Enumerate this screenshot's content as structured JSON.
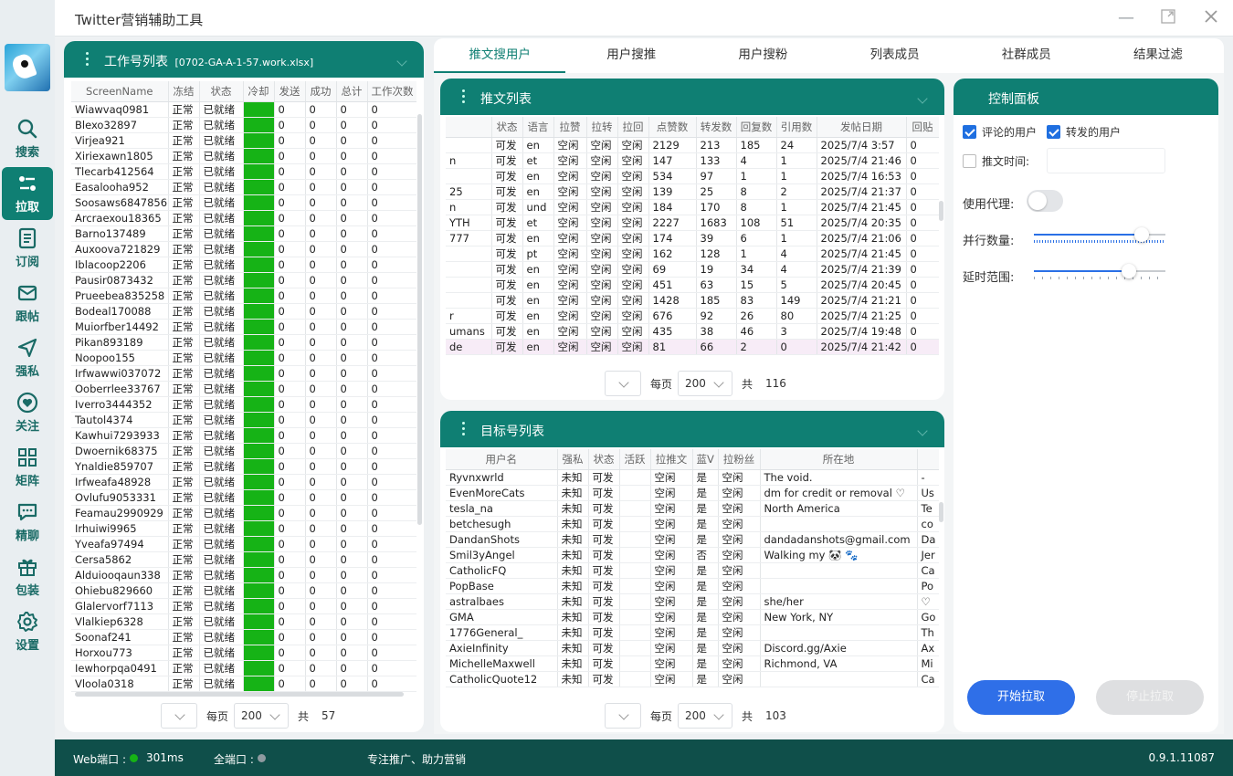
{
  "window": {
    "title": "Twitter营销辅助工具"
  },
  "nav": [
    {
      "key": "search",
      "label": "搜索",
      "icon": "search-icon"
    },
    {
      "key": "pull",
      "label": "拉取",
      "icon": "pull-icon"
    },
    {
      "key": "subscribe",
      "label": "订阅",
      "icon": "document-icon"
    },
    {
      "key": "follow-post",
      "label": "跟帖",
      "icon": "mail-icon"
    },
    {
      "key": "dm",
      "label": "强私",
      "icon": "send-icon"
    },
    {
      "key": "follow",
      "label": "关注",
      "icon": "heart-icon"
    },
    {
      "key": "matrix",
      "label": "矩阵",
      "icon": "grid-icon"
    },
    {
      "key": "chat",
      "label": "精聊",
      "icon": "chat-icon"
    },
    {
      "key": "pack",
      "label": "包装",
      "icon": "gift-icon"
    },
    {
      "key": "settings",
      "label": "设置",
      "icon": "gear-icon"
    }
  ],
  "workers": {
    "title": "工作号列表",
    "file": "[0702-GA-A-1-57.work.xlsx]",
    "columns": [
      "ScreenName",
      "冻结",
      "状态",
      "冷却",
      "发送",
      "成功",
      "总计",
      "工作次数"
    ],
    "rows": [
      [
        "Wiawvaq0981",
        "正常",
        "已就绪",
        "",
        "0",
        "0",
        "0",
        "0"
      ],
      [
        "Blexo32897",
        "正常",
        "已就绪",
        "",
        "0",
        "0",
        "0",
        "0"
      ],
      [
        "Virjea921",
        "正常",
        "已就绪",
        "",
        "0",
        "0",
        "0",
        "0"
      ],
      [
        "Xiriexawn1805",
        "正常",
        "已就绪",
        "",
        "0",
        "0",
        "0",
        "0"
      ],
      [
        "Tlecarb412564",
        "正常",
        "已就绪",
        "",
        "0",
        "0",
        "0",
        "0"
      ],
      [
        "Easalooha952",
        "正常",
        "已就绪",
        "",
        "0",
        "0",
        "0",
        "0"
      ],
      [
        "Soosaws6847856",
        "正常",
        "已就绪",
        "",
        "0",
        "0",
        "0",
        "0"
      ],
      [
        "Arcraexou18365",
        "正常",
        "已就绪",
        "",
        "0",
        "0",
        "0",
        "0"
      ],
      [
        "Barno137489",
        "正常",
        "已就绪",
        "",
        "0",
        "0",
        "0",
        "0"
      ],
      [
        "Auxoova721829",
        "正常",
        "已就绪",
        "",
        "0",
        "0",
        "0",
        "0"
      ],
      [
        "Iblacoop2206",
        "正常",
        "已就绪",
        "",
        "0",
        "0",
        "0",
        "0"
      ],
      [
        "Pausir0873432",
        "正常",
        "已就绪",
        "",
        "0",
        "0",
        "0",
        "0"
      ],
      [
        "Prueebea835258",
        "正常",
        "已就绪",
        "",
        "0",
        "0",
        "0",
        "0"
      ],
      [
        "Bodeal170088",
        "正常",
        "已就绪",
        "",
        "0",
        "0",
        "0",
        "0"
      ],
      [
        "Muiorfber14492",
        "正常",
        "已就绪",
        "",
        "0",
        "0",
        "0",
        "0"
      ],
      [
        "Pikan893189",
        "正常",
        "已就绪",
        "",
        "0",
        "0",
        "0",
        "0"
      ],
      [
        "Noopoo155",
        "正常",
        "已就绪",
        "",
        "0",
        "0",
        "0",
        "0"
      ],
      [
        "Irfwawwi037072",
        "正常",
        "已就绪",
        "",
        "0",
        "0",
        "0",
        "0"
      ],
      [
        "Ooberrlee33767",
        "正常",
        "已就绪",
        "",
        "0",
        "0",
        "0",
        "0"
      ],
      [
        "Iverro3444352",
        "正常",
        "已就绪",
        "",
        "0",
        "0",
        "0",
        "0"
      ],
      [
        "Tautol4374",
        "正常",
        "已就绪",
        "",
        "0",
        "0",
        "0",
        "0"
      ],
      [
        "Kawhui7293933",
        "正常",
        "已就绪",
        "",
        "0",
        "0",
        "0",
        "0"
      ],
      [
        "Dwoernik68375",
        "正常",
        "已就绪",
        "",
        "0",
        "0",
        "0",
        "0"
      ],
      [
        "Ynaldie859707",
        "正常",
        "已就绪",
        "",
        "0",
        "0",
        "0",
        "0"
      ],
      [
        "Irfweafa48928",
        "正常",
        "已就绪",
        "",
        "0",
        "0",
        "0",
        "0"
      ],
      [
        "Ovlufu9053331",
        "正常",
        "已就绪",
        "",
        "0",
        "0",
        "0",
        "0"
      ],
      [
        "Feamau2990929",
        "正常",
        "已就绪",
        "",
        "0",
        "0",
        "0",
        "0"
      ],
      [
        "Irhuiwi9965",
        "正常",
        "已就绪",
        "",
        "0",
        "0",
        "0",
        "0"
      ],
      [
        "Yveafa97494",
        "正常",
        "已就绪",
        "",
        "0",
        "0",
        "0",
        "0"
      ],
      [
        "Cersa5862",
        "正常",
        "已就绪",
        "",
        "0",
        "0",
        "0",
        "0"
      ],
      [
        "Alduiooqaun338",
        "正常",
        "已就绪",
        "",
        "0",
        "0",
        "0",
        "0"
      ],
      [
        "Ohiebu829660",
        "正常",
        "已就绪",
        "",
        "0",
        "0",
        "0",
        "0"
      ],
      [
        "Glalervorf7113",
        "正常",
        "已就绪",
        "",
        "0",
        "0",
        "0",
        "0"
      ],
      [
        "Vlalkiep6328",
        "正常",
        "已就绪",
        "",
        "0",
        "0",
        "0",
        "0"
      ],
      [
        "Soonaf241",
        "正常",
        "已就绪",
        "",
        "0",
        "0",
        "0",
        "0"
      ],
      [
        "Horxou773",
        "正常",
        "已就绪",
        "",
        "0",
        "0",
        "0",
        "0"
      ],
      [
        "Iewhorpqa0491",
        "正常",
        "已就绪",
        "",
        "0",
        "0",
        "0",
        "0"
      ],
      [
        "Vloola0318",
        "正常",
        "已就绪",
        "",
        "0",
        "0",
        "0",
        "0"
      ]
    ],
    "pager": {
      "per_page_label": "每页",
      "per_page": "200",
      "total_label": "共",
      "total": "57"
    }
  },
  "tabs": [
    "推文搜用户",
    "用户搜推",
    "用户搜粉",
    "列表成员",
    "社群成员",
    "结果过滤"
  ],
  "tweets": {
    "title": "推文列表",
    "columns": [
      "",
      "状态",
      "语言",
      "拉赞",
      "拉转",
      "拉回",
      "点赞数",
      "转发数",
      "回复数",
      "引用数",
      "发帖日期",
      "回贴"
    ],
    "rows": [
      [
        "",
        "可发",
        "en",
        "空闲",
        "空闲",
        "空闲",
        "2129",
        "213",
        "185",
        "24",
        "2025/7/4 3:57",
        "0"
      ],
      [
        "n",
        "可发",
        "et",
        "空闲",
        "空闲",
        "空闲",
        "147",
        "133",
        "4",
        "1",
        "2025/7/4 21:46",
        "0"
      ],
      [
        "",
        "可发",
        "en",
        "空闲",
        "空闲",
        "空闲",
        "534",
        "97",
        "1",
        "1",
        "2025/7/4 16:53",
        "0"
      ],
      [
        "25",
        "可发",
        "en",
        "空闲",
        "空闲",
        "空闲",
        "139",
        "25",
        "8",
        "2",
        "2025/7/4 21:37",
        "0"
      ],
      [
        "n",
        "可发",
        "und",
        "空闲",
        "空闲",
        "空闲",
        "184",
        "170",
        "8",
        "1",
        "2025/7/4 21:45",
        "0"
      ],
      [
        "YTH",
        "可发",
        "et",
        "空闲",
        "空闲",
        "空闲",
        "2227",
        "1683",
        "108",
        "51",
        "2025/7/4 20:35",
        "0"
      ],
      [
        "777",
        "可发",
        "en",
        "空闲",
        "空闲",
        "空闲",
        "174",
        "39",
        "6",
        "1",
        "2025/7/4 21:06",
        "0"
      ],
      [
        "",
        "可发",
        "pt",
        "空闲",
        "空闲",
        "空闲",
        "162",
        "128",
        "1",
        "4",
        "2025/7/4 21:45",
        "0"
      ],
      [
        "",
        "可发",
        "en",
        "空闲",
        "空闲",
        "空闲",
        "69",
        "19",
        "34",
        "4",
        "2025/7/4 21:39",
        "0"
      ],
      [
        "",
        "可发",
        "en",
        "空闲",
        "空闲",
        "空闲",
        "451",
        "63",
        "15",
        "5",
        "2025/7/4 20:45",
        "0"
      ],
      [
        "",
        "可发",
        "en",
        "空闲",
        "空闲",
        "空闲",
        "1428",
        "185",
        "83",
        "149",
        "2025/7/4 21:21",
        "0"
      ],
      [
        "r",
        "可发",
        "en",
        "空闲",
        "空闲",
        "空闲",
        "676",
        "92",
        "26",
        "80",
        "2025/7/4 21:25",
        "0"
      ],
      [
        "umans",
        "可发",
        "en",
        "空闲",
        "空闲",
        "空闲",
        "435",
        "38",
        "46",
        "3",
        "2025/7/4 19:48",
        "0"
      ],
      [
        "de",
        "可发",
        "en",
        "空闲",
        "空闲",
        "空闲",
        "81",
        "66",
        "2",
        "0",
        "2025/7/4 21:42",
        "0"
      ]
    ],
    "pager": {
      "per_page_label": "每页",
      "per_page": "200",
      "total_label": "共",
      "total": "116"
    }
  },
  "targets": {
    "title": "目标号列表",
    "columns": [
      "用户名",
      "强私",
      "状态",
      "活跃",
      "拉推文",
      "蓝V",
      "拉粉丝",
      "所在地",
      ""
    ],
    "rows": [
      [
        "Ryvnxwrld",
        "未知",
        "可发",
        "",
        "空闲",
        "是",
        "空闲",
        "The void.",
        "-"
      ],
      [
        "EvenMoreCats",
        "未知",
        "可发",
        "",
        "空闲",
        "是",
        "空闲",
        "dm for credit or removal ♡",
        "Us"
      ],
      [
        "tesla_na",
        "未知",
        "可发",
        "",
        "空闲",
        "是",
        "空闲",
        "North America",
        "Te"
      ],
      [
        "betchesugh",
        "未知",
        "可发",
        "",
        "空闲",
        "是",
        "空闲",
        "",
        "co"
      ],
      [
        "DandanShots",
        "未知",
        "可发",
        "",
        "空闲",
        "是",
        "空闲",
        "dandadanshots@gmail.com",
        "Da"
      ],
      [
        "Smil3yAngel",
        "未知",
        "可发",
        "",
        "空闲",
        "否",
        "空闲",
        "Walking my 🐼 🐾",
        "Jer"
      ],
      [
        "CatholicFQ",
        "未知",
        "可发",
        "",
        "空闲",
        "是",
        "空闲",
        "",
        "Ca"
      ],
      [
        "PopBase",
        "未知",
        "可发",
        "",
        "空闲",
        "是",
        "空闲",
        "",
        "Po"
      ],
      [
        "astralbaes",
        "未知",
        "可发",
        "",
        "空闲",
        "是",
        "空闲",
        "she/her",
        "♡"
      ],
      [
        "GMA",
        "未知",
        "可发",
        "",
        "空闲",
        "是",
        "空闲",
        "New York, NY",
        "Go"
      ],
      [
        "1776General_",
        "未知",
        "可发",
        "",
        "空闲",
        "是",
        "空闲",
        "",
        "Th"
      ],
      [
        "AxieInfinity",
        "未知",
        "可发",
        "",
        "空闲",
        "是",
        "空闲",
        "Discord.gg/Axie",
        "Ax"
      ],
      [
        "MichelleMaxwell",
        "未知",
        "可发",
        "",
        "空闲",
        "是",
        "空闲",
        "Richmond, VA",
        "Mi"
      ],
      [
        "CatholicQuote12",
        "未知",
        "可发",
        "",
        "空闲",
        "是",
        "空闲",
        "",
        "Ca"
      ]
    ],
    "pager": {
      "per_page_label": "每页",
      "per_page": "200",
      "total_label": "共",
      "total": "103"
    }
  },
  "control": {
    "title": "控制面板",
    "cb_comment": "评论的用户",
    "cb_retweet": "转发的用户",
    "cb_time": "推文时间:",
    "proxy": "使用代理:",
    "parallel": "并行数量:",
    "parallel_value": 0.82,
    "delay": "延时范围:",
    "delay_value": 0.72,
    "start": "开始拉取",
    "stop": "停止拉取"
  },
  "status": {
    "web_port": "Web端口 :",
    "latency": "301ms",
    "all_port": "全端口 :",
    "slogan": "专注推广、助力营销",
    "version": "0.9.1.11087"
  },
  "colors": {
    "brand": "#0f7f73",
    "ready": "#16b316",
    "primary": "#2f6fe8"
  }
}
